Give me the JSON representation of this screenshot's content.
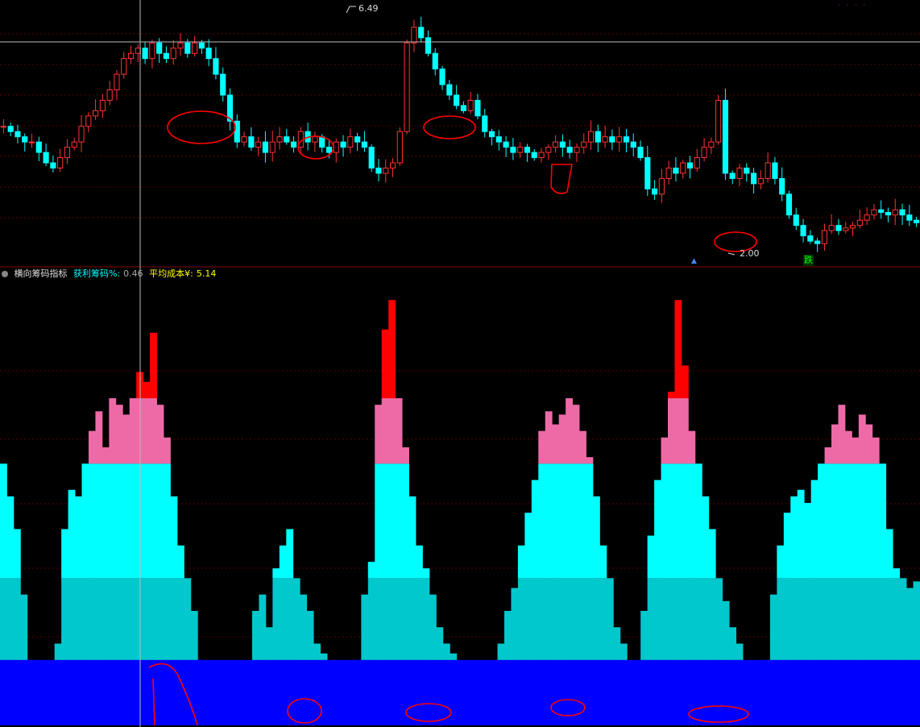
{
  "indicator": {
    "name": "横向筹码指标",
    "profit_label": "获利筹码%:",
    "profit_value": "0.46",
    "avg_cost_label": "平均成本¥:",
    "avg_cost_value": "5.14"
  },
  "price_panel": {
    "high_label": "6.49",
    "low_label": "2.00",
    "signal_label": "跌"
  },
  "colors": {
    "up_candle": "#ff3333",
    "down_candle": "#00ffff",
    "pink_band": "#ee6aa7",
    "red_top": "#ff0000",
    "cyan_band": "#00ffff",
    "teal_band": "#00c8cc",
    "blue_base": "#0000ff",
    "annotation": "#ff0000"
  },
  "chart_data": [
    {
      "type": "candlestick",
      "y_range": [
        1.9,
        6.6
      ],
      "close_series": [
        4.3,
        4.2,
        4.1,
        4.0,
        4.0,
        3.8,
        3.6,
        3.5,
        3.7,
        3.9,
        4.0,
        4.3,
        4.5,
        4.6,
        4.8,
        5.0,
        5.3,
        5.6,
        5.7,
        5.8,
        5.6,
        5.9,
        5.7,
        5.6,
        5.8,
        5.9,
        5.7,
        5.9,
        5.8,
        5.6,
        5.3,
        4.9,
        4.4,
        4.0,
        4.1,
        3.9,
        4.0,
        3.8,
        4.0,
        4.1,
        4.0,
        3.9,
        4.2,
        4.0,
        4.1,
        3.9,
        3.8,
        4.0,
        3.9,
        4.1,
        4.0,
        3.9,
        3.5,
        3.4,
        3.5,
        3.6,
        4.2,
        5.9,
        6.2,
        6.0,
        5.7,
        5.4,
        5.1,
        4.9,
        4.7,
        4.6,
        4.8,
        4.5,
        4.2,
        4.1,
        4.0,
        3.9,
        3.8,
        3.9,
        3.8,
        3.7,
        3.8,
        3.9,
        4.0,
        3.9,
        3.8,
        3.9,
        4.0,
        4.2,
        4.0,
        4.1,
        4.0,
        4.1,
        4.0,
        3.9,
        3.7,
        3.1,
        3.0,
        3.3,
        3.5,
        3.4,
        3.6,
        3.5,
        3.7,
        3.9,
        4.0,
        4.8,
        3.4,
        3.3,
        3.5,
        3.4,
        3.2,
        3.3,
        3.6,
        3.3,
        3.0,
        2.6,
        2.4,
        2.2,
        2.1,
        2.05,
        2.3,
        2.4,
        2.3,
        2.35,
        2.4,
        2.5,
        2.6,
        2.7,
        2.65,
        2.6,
        2.7,
        2.6,
        2.5,
        2.45
      ]
    },
    {
      "type": "bar",
      "bands": [
        0,
        20,
        45,
        80,
        100
      ],
      "values": [
        80,
        70,
        60,
        40,
        20,
        10,
        5,
        12,
        25,
        60,
        72,
        70,
        80,
        90,
        96,
        85,
        100,
        98,
        95,
        100,
        108,
        105,
        120,
        98,
        88,
        70,
        55,
        45,
        35,
        20,
        12,
        10,
        8,
        9,
        11,
        5,
        15,
        35,
        40,
        30,
        48,
        55,
        60,
        45,
        40,
        35,
        25,
        22,
        15,
        10,
        8,
        12,
        20,
        40,
        50,
        98,
        121,
        130,
        100,
        85,
        70,
        55,
        48,
        40,
        30,
        25,
        22,
        15,
        12,
        10,
        8,
        12,
        18,
        25,
        35,
        42,
        55,
        65,
        75,
        90,
        96,
        92,
        95,
        100,
        98,
        90,
        82,
        70,
        55,
        45,
        30,
        25,
        18,
        12,
        35,
        58,
        75,
        88,
        102,
        130,
        110,
        90,
        80,
        70,
        60,
        45,
        38,
        30,
        25,
        18,
        12,
        10,
        20,
        40,
        55,
        65,
        70,
        72,
        68,
        75,
        80,
        85,
        92,
        98,
        90,
        88,
        95,
        92,
        88,
        80,
        60,
        48,
        45,
        42,
        44
      ]
    }
  ]
}
